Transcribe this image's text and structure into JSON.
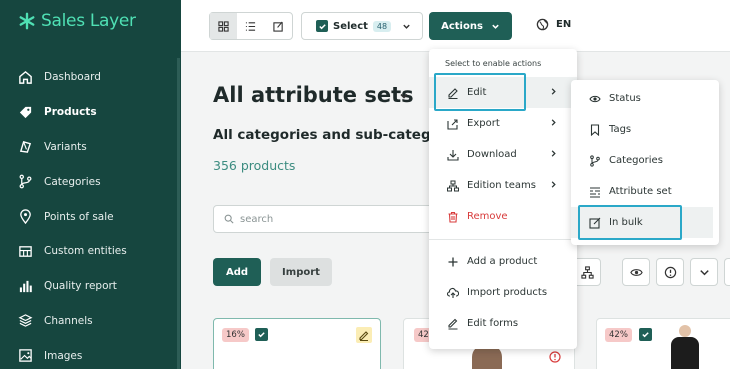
{
  "app": {
    "name": "Sales Layer",
    "brand_color": "#4fe0b4",
    "sidebar_color": "#16463f",
    "accent": "#1f5f56"
  },
  "sidebar": {
    "items": [
      {
        "label": "Dashboard",
        "icon": "home-icon"
      },
      {
        "label": "Products",
        "icon": "tag-icon",
        "active": true
      },
      {
        "label": "Variants",
        "icon": "variants-icon"
      },
      {
        "label": "Categories",
        "icon": "categories-icon"
      },
      {
        "label": "Points of sale",
        "icon": "location-pin-icon"
      },
      {
        "label": "Custom entities",
        "icon": "table-icon"
      },
      {
        "label": "Quality report",
        "icon": "bar-chart-icon"
      },
      {
        "label": "Channels",
        "icon": "layers-icon"
      },
      {
        "label": "Images",
        "icon": "image-icon"
      }
    ]
  },
  "toolbar": {
    "select_label": "Select",
    "select_count": "48",
    "actions_label": "Actions",
    "language": "EN"
  },
  "main": {
    "title": "All attribute sets",
    "subtitle": "All categories and sub-categorie",
    "product_count": "356 products",
    "search_placeholder": "search",
    "add_label": "Add",
    "import_label": "Import"
  },
  "cards": [
    {
      "completeness": "16%"
    },
    {
      "completeness": "42"
    },
    {
      "completeness": "42%"
    }
  ],
  "actions_menu": {
    "hint": "Select to enable actions",
    "items": [
      {
        "label": "Edit",
        "icon": "pencil-icon",
        "has_submenu": true
      },
      {
        "label": "Export",
        "icon": "export-icon",
        "has_submenu": true
      },
      {
        "label": "Download",
        "icon": "download-icon",
        "has_submenu": true
      },
      {
        "label": "Edition teams",
        "icon": "hierarchy-icon",
        "has_submenu": true
      },
      {
        "label": "Remove",
        "icon": "trash-icon"
      },
      {
        "label": "Add a product",
        "icon": "plus-icon"
      },
      {
        "label": "Import products",
        "icon": "cloud-upload-icon"
      },
      {
        "label": "Edit forms",
        "icon": "edit-form-icon"
      }
    ]
  },
  "edit_submenu": {
    "items": [
      {
        "label": "Status",
        "icon": "eye-icon"
      },
      {
        "label": "Tags",
        "icon": "bookmark-icon"
      },
      {
        "label": "Categories",
        "icon": "categories-icon"
      },
      {
        "label": "Attribute set",
        "icon": "attribute-set-icon"
      },
      {
        "label": "In bulk",
        "icon": "bulk-edit-icon"
      }
    ]
  }
}
